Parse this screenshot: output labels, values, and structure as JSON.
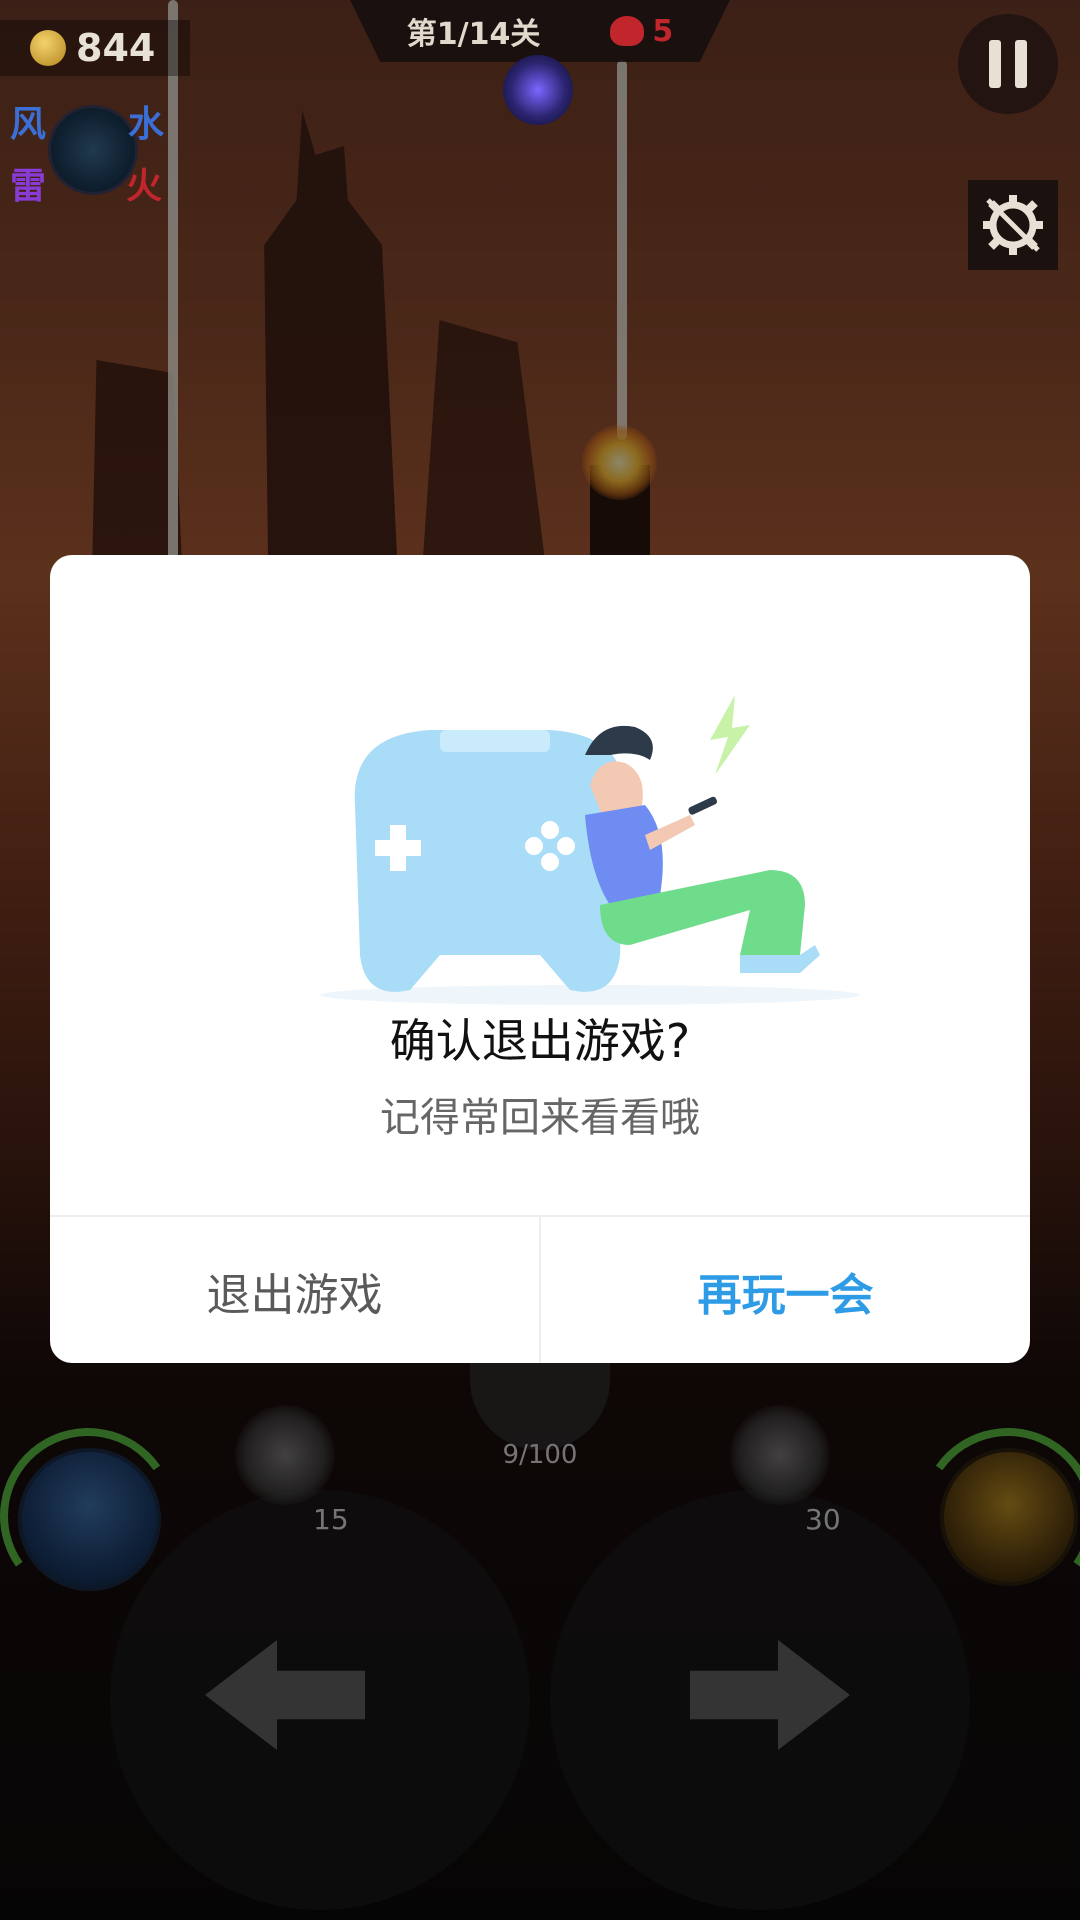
{
  "hud": {
    "coins": "844",
    "stage": "第1/14关",
    "kills": "5",
    "elements": {
      "wind": "风",
      "water": "水",
      "thunder": "雷",
      "fire": "火"
    },
    "icons": {
      "coin": "coin-icon",
      "skull": "skull-icon",
      "pause": "pause-icon",
      "settings": "settings-gear-icon"
    }
  },
  "dialog": {
    "title": "确认退出游戏?",
    "subtitle": "记得常回来看看哦",
    "quit_label": "退出游戏",
    "stay_label": "再玩一会",
    "colors": {
      "stay": "#2d9be6",
      "quit": "#5a5a5a"
    }
  },
  "controls": {
    "left_skill_cost": "15",
    "right_skill_cost": "30",
    "energy": "9/100"
  }
}
